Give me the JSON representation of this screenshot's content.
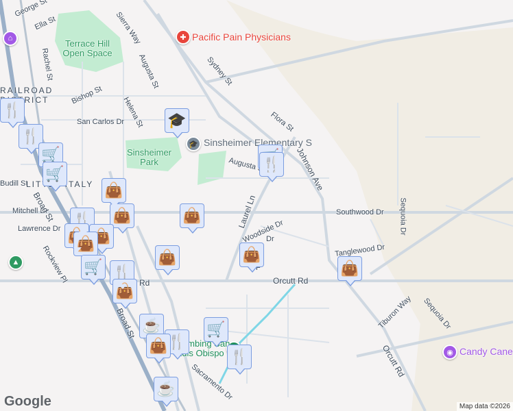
{
  "streets": [
    "George St",
    "Ella St",
    "Rachel St",
    "Sierra Way",
    "Augusta St",
    "Sydney St",
    "Bishop St",
    "Helena St",
    "San Carlos Dr",
    "Flora St",
    "Augusta St",
    "Johnson Ave",
    "Laurel Ln",
    "Southwood Dr",
    "Sequoia Dr",
    "Mitchell Dr",
    "Lawrence Dr",
    "Woodside Dr",
    "Tanglewood Dr",
    "Orcutt Rd",
    "Orcutt Rd",
    "Rockview Pl",
    "Broad St",
    "Broad St",
    "Tiburon Way",
    "Sequoia Dr",
    "Orcutt Rd",
    "Sacramento Dr",
    "Rd",
    "Budill St",
    "Dr",
    "F"
  ],
  "districts": [
    "RAILROAD DISTRICT",
    "LITTLE ITALY"
  ],
  "parks": [
    "Terrace Hill Open Space",
    "Sinsheimer Park"
  ],
  "pois": {
    "pacific_pain": {
      "label": "Pacific Pain Physicians",
      "color": "#e8453c"
    },
    "sinsheimer_school": {
      "label": "Sinsheimer Elementary S",
      "color": "#7a8a99"
    },
    "candy_cane": {
      "label": "Candy Cane",
      "color": "#a259e6"
    },
    "climbing": {
      "label": "Climbing San Luis Obispo",
      "color": "#1e8e5a"
    }
  },
  "markers": [
    "restaurant",
    "restaurant",
    "grocery",
    "grocery",
    "shopping",
    "restaurant",
    "shopping",
    "shopping",
    "shopping",
    "shopping",
    "shopping",
    "shopping",
    "shopping",
    "grocery",
    "restaurant",
    "shopping",
    "school",
    "grocery",
    "restaurant",
    "cafe",
    "shopping",
    "restaurant",
    "grocery",
    "restaurant",
    "cafe"
  ],
  "footer": {
    "logo": "Google",
    "attribution": "Map data ©2026"
  }
}
